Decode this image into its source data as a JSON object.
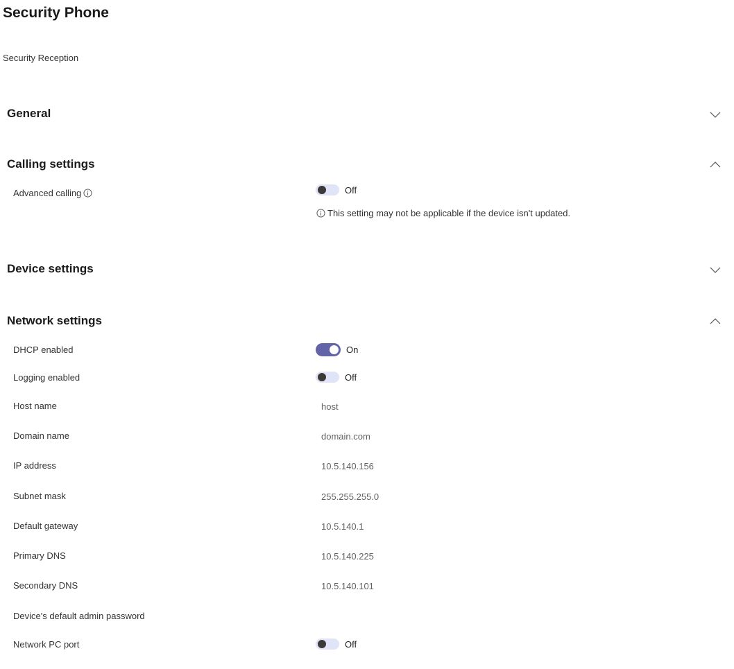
{
  "page": {
    "title": "Security Phone",
    "subtitle": "Security Reception"
  },
  "sections": {
    "general": {
      "title": "General",
      "expanded": false,
      "icon": "chevron-down-icon"
    },
    "calling": {
      "title": "Calling settings",
      "expanded": true,
      "icon": "chevron-up-icon",
      "advanced_calling": {
        "label": "Advanced calling",
        "state": "Off",
        "icon": "info-icon"
      },
      "note": "This setting may not be applicable if the device isn't updated."
    },
    "device": {
      "title": "Device settings",
      "expanded": false,
      "icon": "chevron-down-icon"
    },
    "network": {
      "title": "Network settings",
      "expanded": true,
      "icon": "chevron-up-icon",
      "dhcp": {
        "label": "DHCP enabled",
        "state": "On"
      },
      "logging": {
        "label": "Logging enabled",
        "state": "Off"
      },
      "host_name": {
        "label": "Host name",
        "value": "host"
      },
      "domain_name": {
        "label": "Domain name",
        "value": "domain.com"
      },
      "ip_address": {
        "label": "IP address",
        "value": "10.5.140.156"
      },
      "subnet_mask": {
        "label": "Subnet mask",
        "value": "255.255.255.0"
      },
      "default_gateway": {
        "label": "Default gateway",
        "value": "10.5.140.1"
      },
      "primary_dns": {
        "label": "Primary DNS",
        "value": "10.5.140.225"
      },
      "secondary_dns": {
        "label": "Secondary DNS",
        "value": "10.5.140.101"
      },
      "admin_password": {
        "label": "Device's default admin password",
        "value": ""
      },
      "pc_port": {
        "label": "Network PC port",
        "state": "Off"
      }
    }
  },
  "colors": {
    "accent": "#6264a7",
    "toggle_off_track": "#e1e3f6",
    "text": "#242424",
    "value_text": "#616161"
  }
}
